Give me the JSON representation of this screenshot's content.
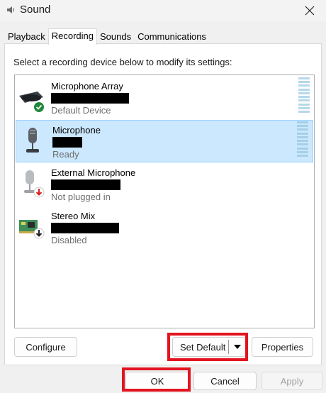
{
  "window": {
    "title": "Sound",
    "app_icon": "speaker-icon",
    "close_icon": "close-icon"
  },
  "tabs": [
    {
      "label": "Playback",
      "active": false
    },
    {
      "label": "Recording",
      "active": true
    },
    {
      "label": "Sounds",
      "active": false
    },
    {
      "label": "Communications",
      "active": false
    }
  ],
  "panel": {
    "instruction": "Select a recording device below to modify its settings:"
  },
  "devices": [
    {
      "name": "Microphone Array",
      "status": "Default Device",
      "icon": "microphone-array-icon",
      "badge": "default-check-icon",
      "selected": false
    },
    {
      "name": "Microphone",
      "status": "Ready",
      "icon": "microphone-icon",
      "badge": "",
      "selected": true
    },
    {
      "name": "External Microphone",
      "status": "Not plugged in",
      "icon": "external-microphone-icon",
      "badge": "unplugged-arrow-icon",
      "selected": false
    },
    {
      "name": "Stereo Mix",
      "status": "Disabled",
      "icon": "stereo-mix-icon",
      "badge": "disabled-arrow-icon",
      "selected": false
    }
  ],
  "buttons": {
    "configure": "Configure",
    "set_default": "Set Default",
    "properties": "Properties",
    "ok": "OK",
    "cancel": "Cancel",
    "apply": "Apply"
  },
  "colors": {
    "highlight": "#e3141f",
    "selection": "#cce8ff",
    "check_green": "#1f8a3a",
    "unplugged_red": "#d42020"
  }
}
